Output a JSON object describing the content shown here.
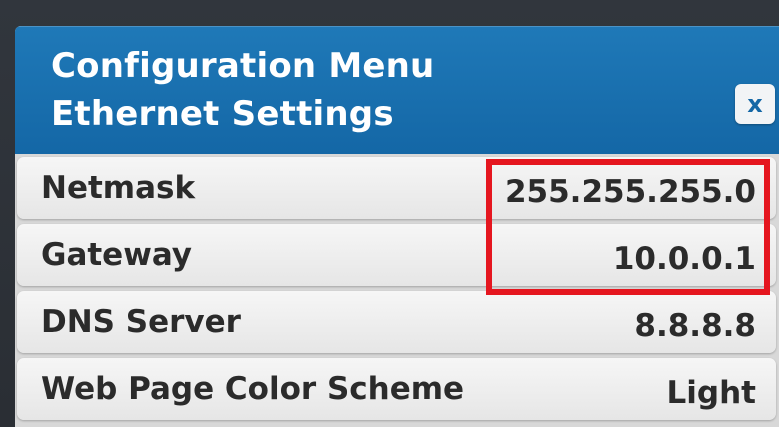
{
  "header": {
    "title": "Configuration Menu",
    "subtitle": "Ethernet Settings",
    "close_label": "x"
  },
  "settings": [
    {
      "label": "Netmask",
      "value": "255.255.255.0"
    },
    {
      "label": "Gateway",
      "value": "10.0.0.1"
    },
    {
      "label": "DNS Server",
      "value": "8.8.8.8"
    },
    {
      "label": "Web Page Color Scheme",
      "value": "Light"
    }
  ],
  "colors": {
    "header_blue": "#1670ad",
    "highlight_red": "#e5161f",
    "row_background": "#eeeeee",
    "text_dark": "#2b2b2b"
  },
  "icons": {
    "close": "close-icon"
  }
}
